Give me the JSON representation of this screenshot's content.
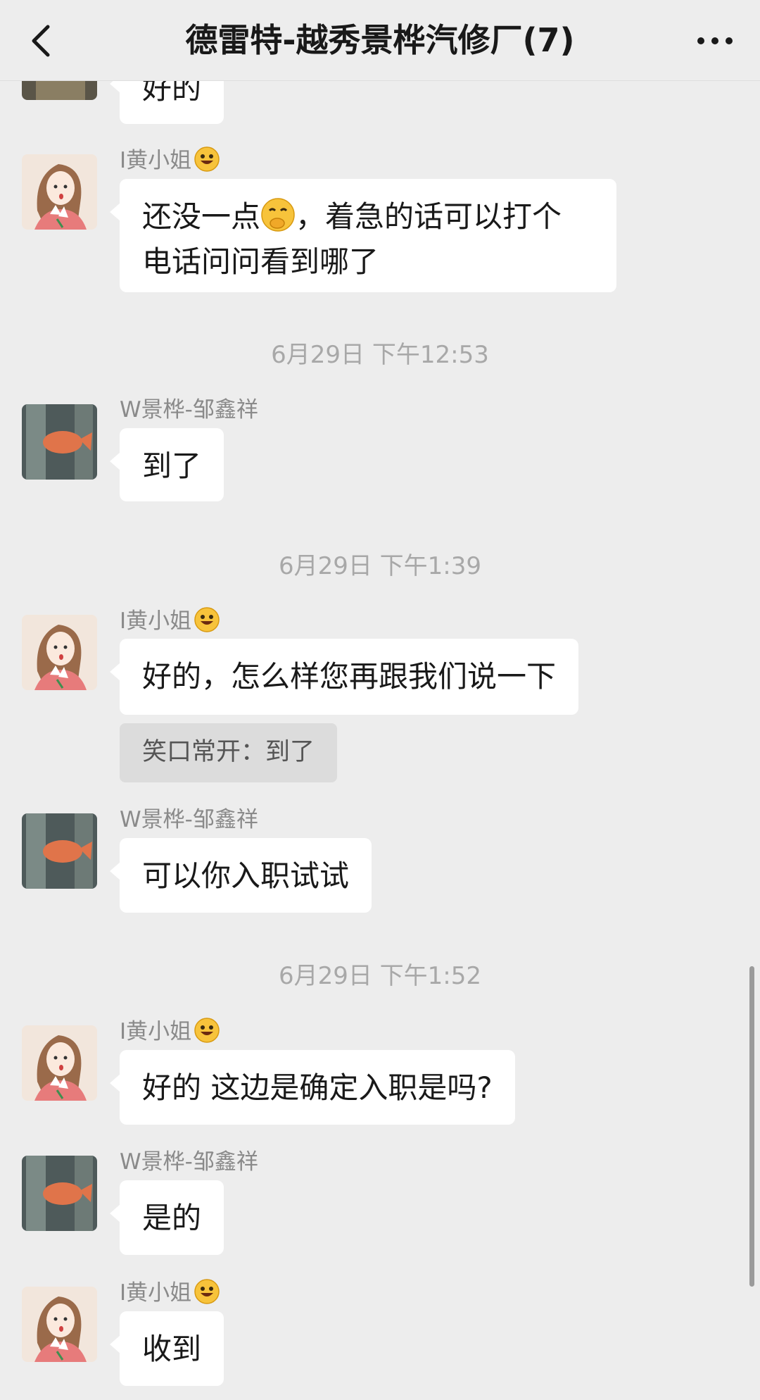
{
  "header": {
    "title": "德雷特-越秀景桦汽修厂(7)",
    "back_icon": "chevron-left-icon",
    "more_icon": "more-dots-icon"
  },
  "messages": {
    "m0": {
      "text": "好的"
    },
    "m1": {
      "sender": "I黄小姐",
      "text_a": "还没一点",
      "text_b": "，着急的话可以打个",
      "text_c": "电话问问看到哪了"
    },
    "t1": "6月29日 下午12:53",
    "m2": {
      "sender": "W景桦-邹鑫祥",
      "text": "到了"
    },
    "t2": "6月29日 下午1:39",
    "m3": {
      "sender": "I黄小姐",
      "text": "好的，怎么样您再跟我们说一下",
      "quote": "笑口常开：到了"
    },
    "m4": {
      "sender": "W景桦-邹鑫祥",
      "text": "可以你入职试试"
    },
    "t3": "6月29日 下午1:52",
    "m5": {
      "sender": "I黄小姐",
      "text": "好的 这边是确定入职是吗?"
    },
    "m6": {
      "sender": "W景桦-邹鑫祥",
      "text": "是的"
    },
    "m7": {
      "sender": "I黄小姐",
      "text": "收到"
    }
  },
  "colors": {
    "background": "#ededed",
    "bubble": "#ffffff",
    "timestamp": "#a8a8a8",
    "sender": "#8a8a8a"
  }
}
